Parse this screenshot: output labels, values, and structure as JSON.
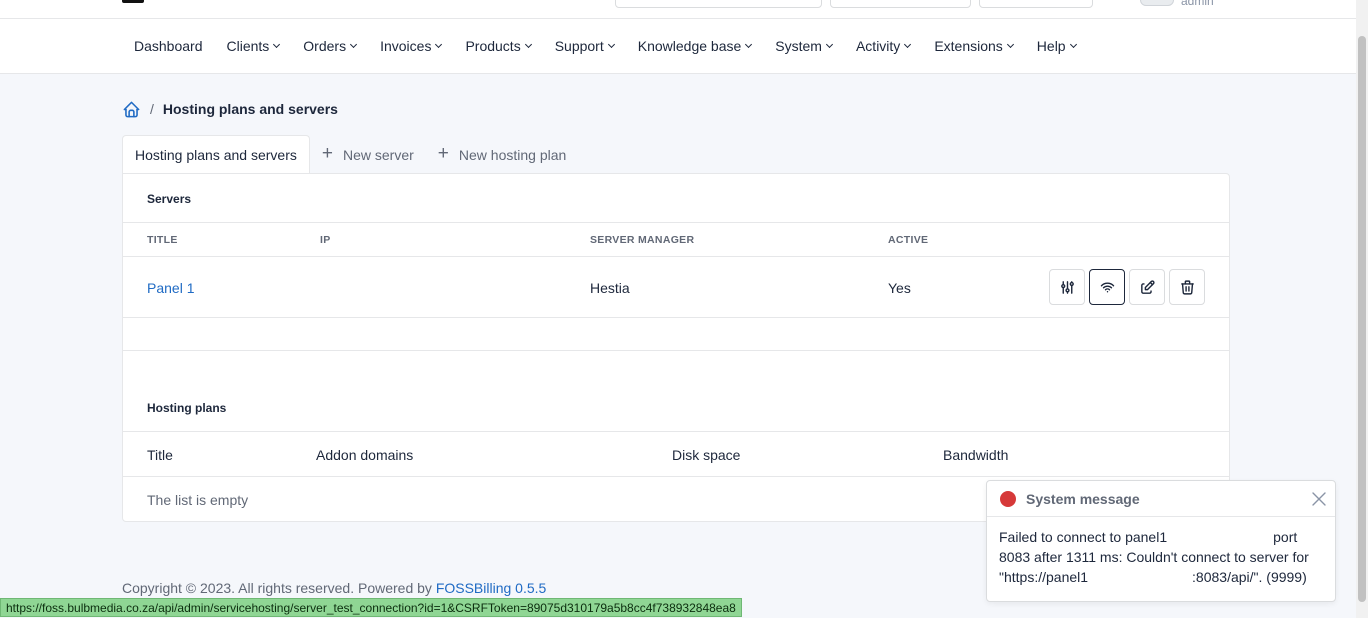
{
  "header": {
    "user_name": "admin"
  },
  "nav": {
    "items": [
      {
        "label": "Dashboard",
        "dropdown": false
      },
      {
        "label": "Clients",
        "dropdown": true
      },
      {
        "label": "Orders",
        "dropdown": true
      },
      {
        "label": "Invoices",
        "dropdown": true
      },
      {
        "label": "Products",
        "dropdown": true
      },
      {
        "label": "Support",
        "dropdown": true
      },
      {
        "label": "Knowledge base",
        "dropdown": true
      },
      {
        "label": "System",
        "dropdown": true
      },
      {
        "label": "Activity",
        "dropdown": true
      },
      {
        "label": "Extensions",
        "dropdown": true
      },
      {
        "label": "Help",
        "dropdown": true
      }
    ]
  },
  "breadcrumb": {
    "separator": "/",
    "current": "Hosting plans and servers"
  },
  "tabs": [
    {
      "label": "Hosting plans and servers",
      "active": true
    },
    {
      "label": "New server",
      "icon": "plus-icon"
    },
    {
      "label": "New hosting plan",
      "icon": "plus-icon"
    }
  ],
  "servers": {
    "section_title": "Servers",
    "columns": [
      "TITLE",
      "IP",
      "SERVER MANAGER",
      "ACTIVE"
    ],
    "rows": [
      {
        "title": "Panel 1",
        "ip": "",
        "manager": "Hestia",
        "active": "Yes"
      }
    ],
    "actions": [
      "sliders-icon",
      "wifi-icon",
      "edit-icon",
      "trash-icon"
    ]
  },
  "hosting_plans": {
    "section_title": "Hosting plans",
    "columns": [
      "Title",
      "Addon domains",
      "Disk space",
      "Bandwidth"
    ],
    "empty_text": "The list is empty"
  },
  "footer": {
    "text": "Copyright © 2023. All rights reserved. Powered by",
    "link_text": "FOSSBilling 0.5.5"
  },
  "status_url": "https://foss.bulbmedia.co.za/api/admin/servicehosting/server_test_connection?id=1&CSRFToken=89075d310179a5b8cc4f738932848ea8",
  "toast": {
    "title": "System message",
    "line1_a": "Failed to connect to panel1",
    "line1_b": "port",
    "line2": "8083 after 1311 ms: Couldn't connect to server for",
    "line3_a": "\"https://panel1",
    "line3_b": ":8083/api/\". (9999)"
  },
  "colors": {
    "primary": "#206bc4",
    "danger": "#d63939",
    "status_bar": "#8fd694"
  }
}
